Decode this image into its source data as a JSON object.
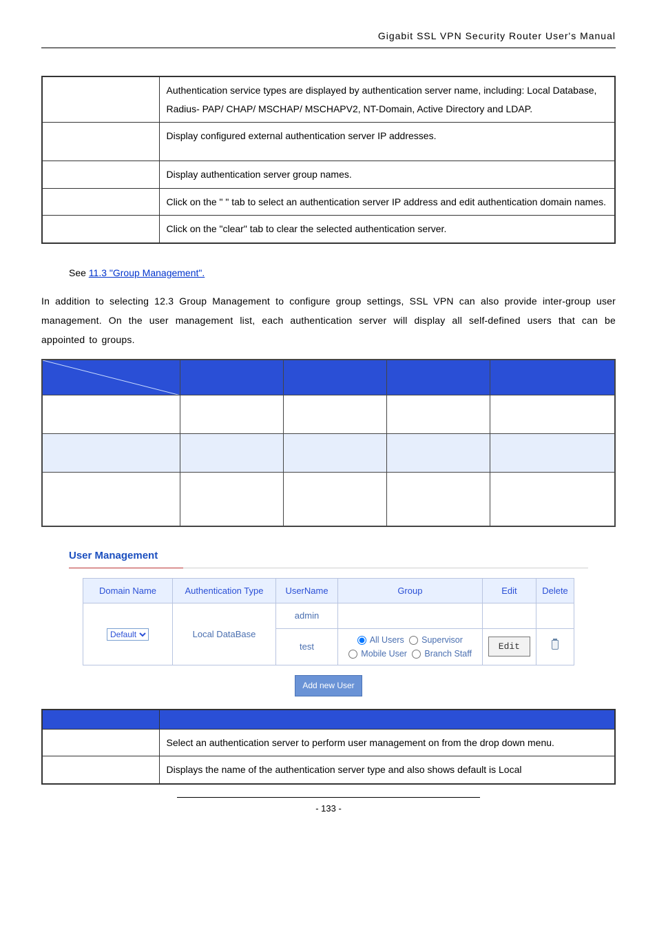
{
  "header": {
    "title": "Gigabit SSL VPN Security Router User's Manual"
  },
  "top_table": {
    "rows": [
      {
        "left": "",
        "right": "Authentication service types are displayed by authentication server name, including: Local Database, Radius- PAP/ CHAP/ MSCHAP/ MSCHAPV2, NT-Domain, Active Directory and LDAP."
      },
      {
        "left": "",
        "right": "Display configured external authentication server IP addresses."
      },
      {
        "left": "",
        "right": "Display authentication server group names."
      },
      {
        "left": "",
        "right": "Click on the \"   \" tab to select an authentication server IP address and edit authentication domain names."
      },
      {
        "left": "",
        "right": "Click on the \"clear\" tab to clear the selected authentication server."
      }
    ]
  },
  "see_link_prefix": "See ",
  "see_link_text": "11.3 \"Group Management\".",
  "paragraph": " In addition to selecting 12.3 Group Management to configure group settings, SSL VPN can also provide inter-group user management. On the user management list, each authentication server will display all self-defined users that can be appointed to groups.",
  "user_mgmt": {
    "heading": "User Management",
    "headers": {
      "domain": "Domain Name",
      "auth": "Authentication Type",
      "user": "UserName",
      "group": "Group",
      "edit": "Edit",
      "delete": "Delete"
    },
    "domain_option": "Default",
    "auth_type": "Local DataBase",
    "row1_user": "admin",
    "row2_user": "test",
    "group_options": {
      "all_users": "All Users",
      "supervisor": "Supervisor",
      "mobile_user": "Mobile User",
      "branch_staff": "Branch Staff"
    },
    "edit_label": "Edit",
    "add_btn": "Add new User"
  },
  "bottom_table": {
    "rows": [
      {
        "left": "",
        "right": "Select an authentication server to perform user management on from the drop down menu."
      },
      {
        "left": "",
        "right": "Displays the name of the authentication server type and also shows default is Local"
      }
    ]
  },
  "footer": "- 133 -"
}
